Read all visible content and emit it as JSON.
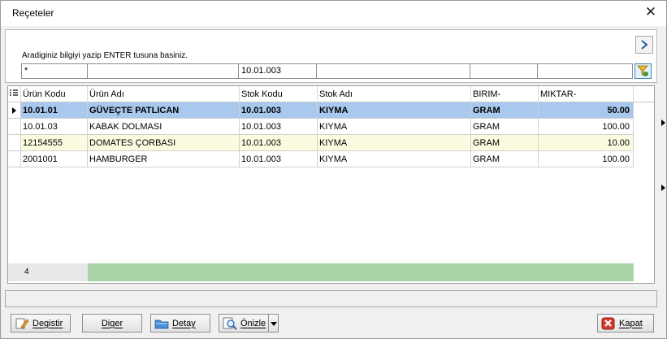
{
  "window": {
    "title": "Reçeteler",
    "close_glyph": "✕"
  },
  "filter": {
    "hint": "Aradiginiz bilgiyi yazip ENTER tusuna basiniz.",
    "values": [
      "*",
      "",
      "10.01.003",
      "",
      "",
      ""
    ]
  },
  "grid": {
    "columns": [
      "Ürün Kodu",
      "Ürün Adı",
      "Stok Kodu",
      "Stok Adı",
      "BIRIM-",
      "MIKTAR-"
    ],
    "rows": [
      [
        "10.01.01",
        "GÜVEÇTE PATLICAN",
        "10.01.003",
        "KIYMA",
        "GRAM",
        "50.00"
      ],
      [
        "10.01.03",
        "KABAK DOLMASI",
        "10.01.003",
        "KIYMA",
        "GRAM",
        "100.00"
      ],
      [
        "12154555",
        "DOMATES ÇORBASI",
        "10.01.003",
        "KIYMA",
        "GRAM",
        "10.00"
      ],
      [
        "2001001",
        "HAMBURGER",
        "10.01.003",
        "KIYMA",
        "GRAM",
        "100.00"
      ]
    ],
    "row_count": "4",
    "colors": {
      "selected": "#a9c8ee",
      "alt": "#fbfbe0",
      "footer": "#a8d4a8"
    }
  },
  "buttons": {
    "degistir": "Degistir",
    "diger": "Diger",
    "detay": "Detay",
    "onizle": "Önizle",
    "kapat": "Kapat"
  },
  "icons": {
    "nav": "chevron-right-icon",
    "filter": "filter-icon",
    "edit": "pencil-icon",
    "detail": "folder-icon",
    "preview": "magnifier-icon",
    "close": "close-icon"
  }
}
